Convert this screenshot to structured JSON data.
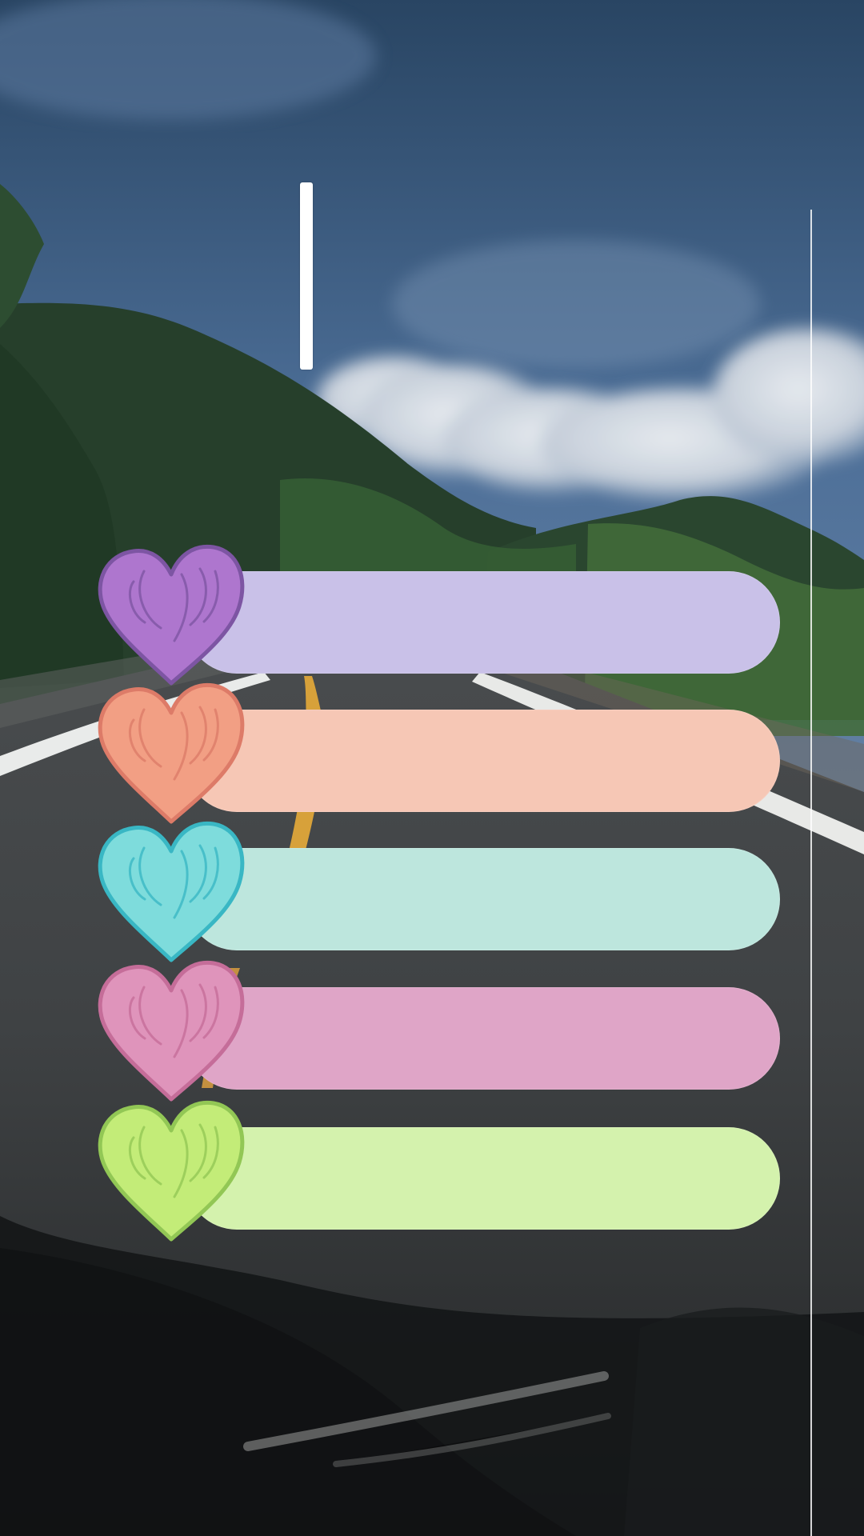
{
  "background": {
    "sky": "#476b94",
    "sky_dark": "#26405f",
    "cloud": "#d9dde2",
    "mountain": "#263f2b",
    "forest": "#3d6f3b",
    "road": "#3d4042",
    "road_line_white": "#eef0ef",
    "road_line_yellow": "#d8a338",
    "shadow": "#141617"
  },
  "stickers": [
    {
      "name": "purple",
      "heart": "#ae76ce",
      "stroke": "#7d55a3",
      "bar": "#c9c1e8"
    },
    {
      "name": "peach",
      "heart": "#f29f84",
      "stroke": "#dd7b68",
      "bar": "#f6c7b5"
    },
    {
      "name": "aqua",
      "heart": "#7edcdc",
      "stroke": "#39b7c4",
      "bar": "#bde6dd"
    },
    {
      "name": "pink",
      "heart": "#df94bb",
      "stroke": "#c56d99",
      "bar": "#dfa5c7"
    },
    {
      "name": "lime",
      "heart": "#c3ec78",
      "stroke": "#92c755",
      "bar": "#d4f2ad"
    }
  ],
  "icons": {
    "text_cursor": "text-cursor-icon",
    "guide": "vertical-guide-icon",
    "heart": "heart-icon"
  }
}
